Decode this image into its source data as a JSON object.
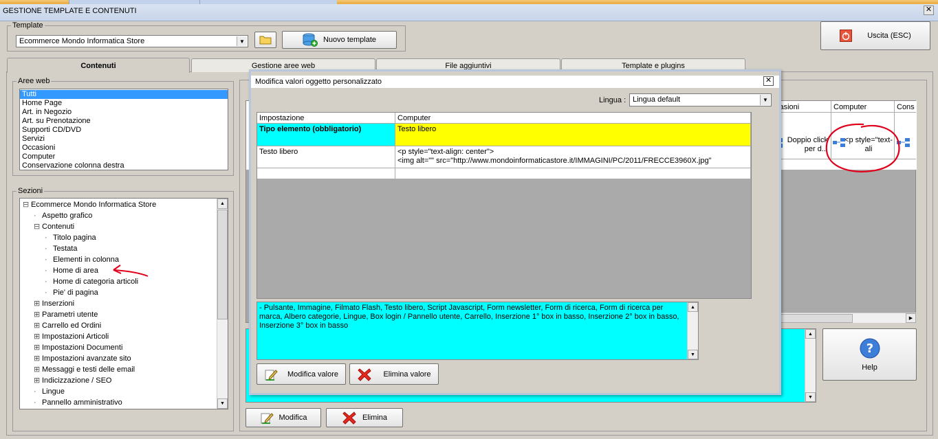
{
  "window": {
    "title": "GESTIONE TEMPLATE E CONTENUTI",
    "close_glyph": "✕"
  },
  "template_group": {
    "legend": "Template",
    "selected": "Ecommerce Mondo Informatica Store",
    "new_button": "Nuovo template"
  },
  "exit_button": "Uscita (ESC)",
  "tabs": [
    {
      "label": "Contenuti",
      "active": true
    },
    {
      "label": "Gestione aree web",
      "active": false
    },
    {
      "label": "File aggiuntivi",
      "active": false
    },
    {
      "label": "Template e plugins",
      "active": false
    }
  ],
  "aree_web": {
    "legend": "Aree web",
    "items": [
      "Tutti",
      "Home Page",
      "Art. in Negozio",
      "Art. su Prenotazione",
      "Supporti CD/DVD",
      "Servizi",
      "Occasioni",
      "Computer",
      "Conservazione colonna destra"
    ],
    "selected_index": 0
  },
  "sezioni": {
    "legend": "Sezioni",
    "tree": [
      {
        "label": "Ecommerce Mondo Informatica Store",
        "level": 0,
        "expander": "⊟"
      },
      {
        "label": "Aspetto grafico",
        "level": 1,
        "expander": ""
      },
      {
        "label": "Contenuti",
        "level": 1,
        "expander": "⊟"
      },
      {
        "label": "Titolo pagina",
        "level": 2,
        "expander": ""
      },
      {
        "label": "Testata",
        "level": 2,
        "expander": ""
      },
      {
        "label": "Elementi in colonna",
        "level": 2,
        "expander": ""
      },
      {
        "label": "Home di area",
        "level": 2,
        "expander": ""
      },
      {
        "label": "Home di categoria articoli",
        "level": 2,
        "expander": ""
      },
      {
        "label": "Pie' di pagina",
        "level": 2,
        "expander": ""
      },
      {
        "label": "Inserzioni",
        "level": 1,
        "expander": "⊞"
      },
      {
        "label": "Parametri utente",
        "level": 1,
        "expander": "⊞"
      },
      {
        "label": "Carrello ed Ordini",
        "level": 1,
        "expander": "⊞"
      },
      {
        "label": "Impostazioni Articoli",
        "level": 1,
        "expander": "⊞"
      },
      {
        "label": "Impostazioni Documenti",
        "level": 1,
        "expander": "⊞"
      },
      {
        "label": "Impostazioni avanzate sito",
        "level": 1,
        "expander": "⊞"
      },
      {
        "label": "Messaggi e testi delle email",
        "level": 1,
        "expander": "⊞"
      },
      {
        "label": "Indicizzazione / SEO",
        "level": 1,
        "expander": "⊞"
      },
      {
        "label": "Lingue",
        "level": 1,
        "expander": ""
      },
      {
        "label": "Pannello amministrativo",
        "level": 1,
        "expander": ""
      }
    ]
  },
  "bg_grid": {
    "headers": [
      "casioni",
      "Computer",
      "Cons"
    ],
    "cells": [
      "Doppio click per d...",
      "<p style=\"text-ali",
      ""
    ]
  },
  "bottom_buttons": {
    "modifica": "Modifica",
    "elimina": "Elimina",
    "help": "Help"
  },
  "dialog": {
    "title": "Modifica valori oggetto personalizzato",
    "lingua_label": "Lingua :",
    "lingua_value": "Lingua default",
    "grid": {
      "col1": "Impostazione",
      "col2": "Computer",
      "rows": [
        {
          "key": "Tipo elemento (obbligatorio)",
          "value": "Testo libero",
          "highlight": true
        },
        {
          "key": "Testo libero",
          "value": "<p style=\"text-align: center\">",
          "value2": "<img alt=\"\" src=\"http://www.mondoinformaticastore.it/IMMAGINI/PC/2011/FRECCE3960X.jpg\"",
          "highlight": false
        }
      ]
    },
    "description": "- Pulsante, Immagine, Filmato Flash, Testo libero, Script Javascript, Form newsletter, Form di ricerca, Form di ricerca per marca, Albero categorie, Lingue, Box login / Pannello utente, Carrello, Inserzione 1° box in basso, Inserzione 2° box in basso, Inserzione 3° box in basso",
    "modifica_valore": "Modifica valore",
    "elimina_valore": "Elimina valore"
  },
  "colors": {
    "highlight_cyan": "#00ffff",
    "highlight_yellow": "#ffff00",
    "selection_blue": "#3399ff",
    "annotation_red": "#e0001b"
  }
}
